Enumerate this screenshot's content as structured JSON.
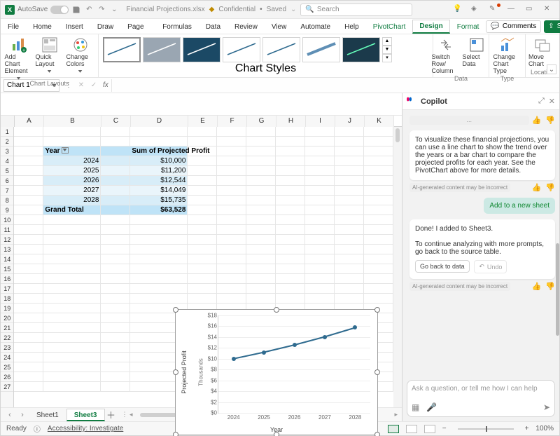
{
  "titlebar": {
    "autosave_label": "AutoSave",
    "autosave_on": true,
    "filename": "Financial Projections.xlsx",
    "confidentiality": "Confidential",
    "saved_state": "Saved",
    "search_placeholder": "Search"
  },
  "tabs": {
    "items": [
      "File",
      "Home",
      "Insert",
      "Draw",
      "Page Layout",
      "Formulas",
      "Data",
      "Review",
      "View",
      "Automate",
      "Help",
      "PivotChart Analyze",
      "Design",
      "Format"
    ],
    "pivot_idx": 11,
    "active_idx": 12,
    "format_idx": 13,
    "comments": "Comments",
    "share": "Share"
  },
  "ribbon": {
    "chart_layouts": {
      "label": "Chart Layouts",
      "add_chart_element": "Add Chart Element",
      "quick_layout": "Quick Layout",
      "change_colors": "Change Colors"
    },
    "chart_styles_label": "Chart Styles",
    "data_group": {
      "label": "Data",
      "switch": "Switch Row/ Column",
      "select": "Select Data"
    },
    "type_group": {
      "label": "Type",
      "change": "Change Chart Type"
    },
    "location_group": {
      "label": "Location",
      "move": "Move Chart"
    }
  },
  "fbar": {
    "name": "Chart 1"
  },
  "grid": {
    "columns": [
      "A",
      "B",
      "C",
      "D",
      "E",
      "F",
      "G",
      "H",
      "I",
      "J",
      "K"
    ],
    "rows_show": 27,
    "pivot": {
      "col_left": "Year",
      "col_right": "Sum of Projected Profit",
      "rows": [
        {
          "year": "2024",
          "val": "$10,000"
        },
        {
          "year": "2025",
          "val": "$11,200"
        },
        {
          "year": "2026",
          "val": "$12,544"
        },
        {
          "year": "2027",
          "val": "$14,049"
        },
        {
          "year": "2028",
          "val": "$15,735"
        }
      ],
      "grand_label": "Grand Total",
      "grand_val": "$63,528"
    }
  },
  "chart_data": {
    "type": "line",
    "title": "",
    "xlabel": "Year",
    "ylabel": "Projected Profit",
    "yunits": "Thousands",
    "categories": [
      "2024",
      "2025",
      "2026",
      "2027",
      "2028"
    ],
    "values": [
      10.0,
      11.2,
      12.544,
      14.049,
      15.735
    ],
    "ylim": [
      0,
      18
    ],
    "yticks": [
      "$0",
      "$2",
      "$4",
      "$6",
      "$8",
      "$10",
      "$12",
      "$14",
      "$16",
      "$18"
    ]
  },
  "sheet_tabs": {
    "items": [
      "Sheet1",
      "Sheet3"
    ],
    "active_idx": 1
  },
  "copilot": {
    "title": "Copilot",
    "bubble1": "To visualize these financial projections, you can use a line chart to show the trend over the years or a bar chart to compare the projected profits for each year. See the PivotChart above for more details.",
    "caption": "AI-generated content may be incorrect",
    "user_msg": "Add to a new sheet",
    "bubble2_a": "Done! I added  to Sheet3.",
    "bubble2_b": "To continue analyzing with more prompts, go back to the source table.",
    "chip_goback": "Go back to data",
    "chip_undo": "Undo",
    "input_placeholder": "Ask a question, or tell me how I can help"
  },
  "status": {
    "ready": "Ready",
    "accessibility": "Accessibility: Investigate",
    "zoom": "100%"
  }
}
